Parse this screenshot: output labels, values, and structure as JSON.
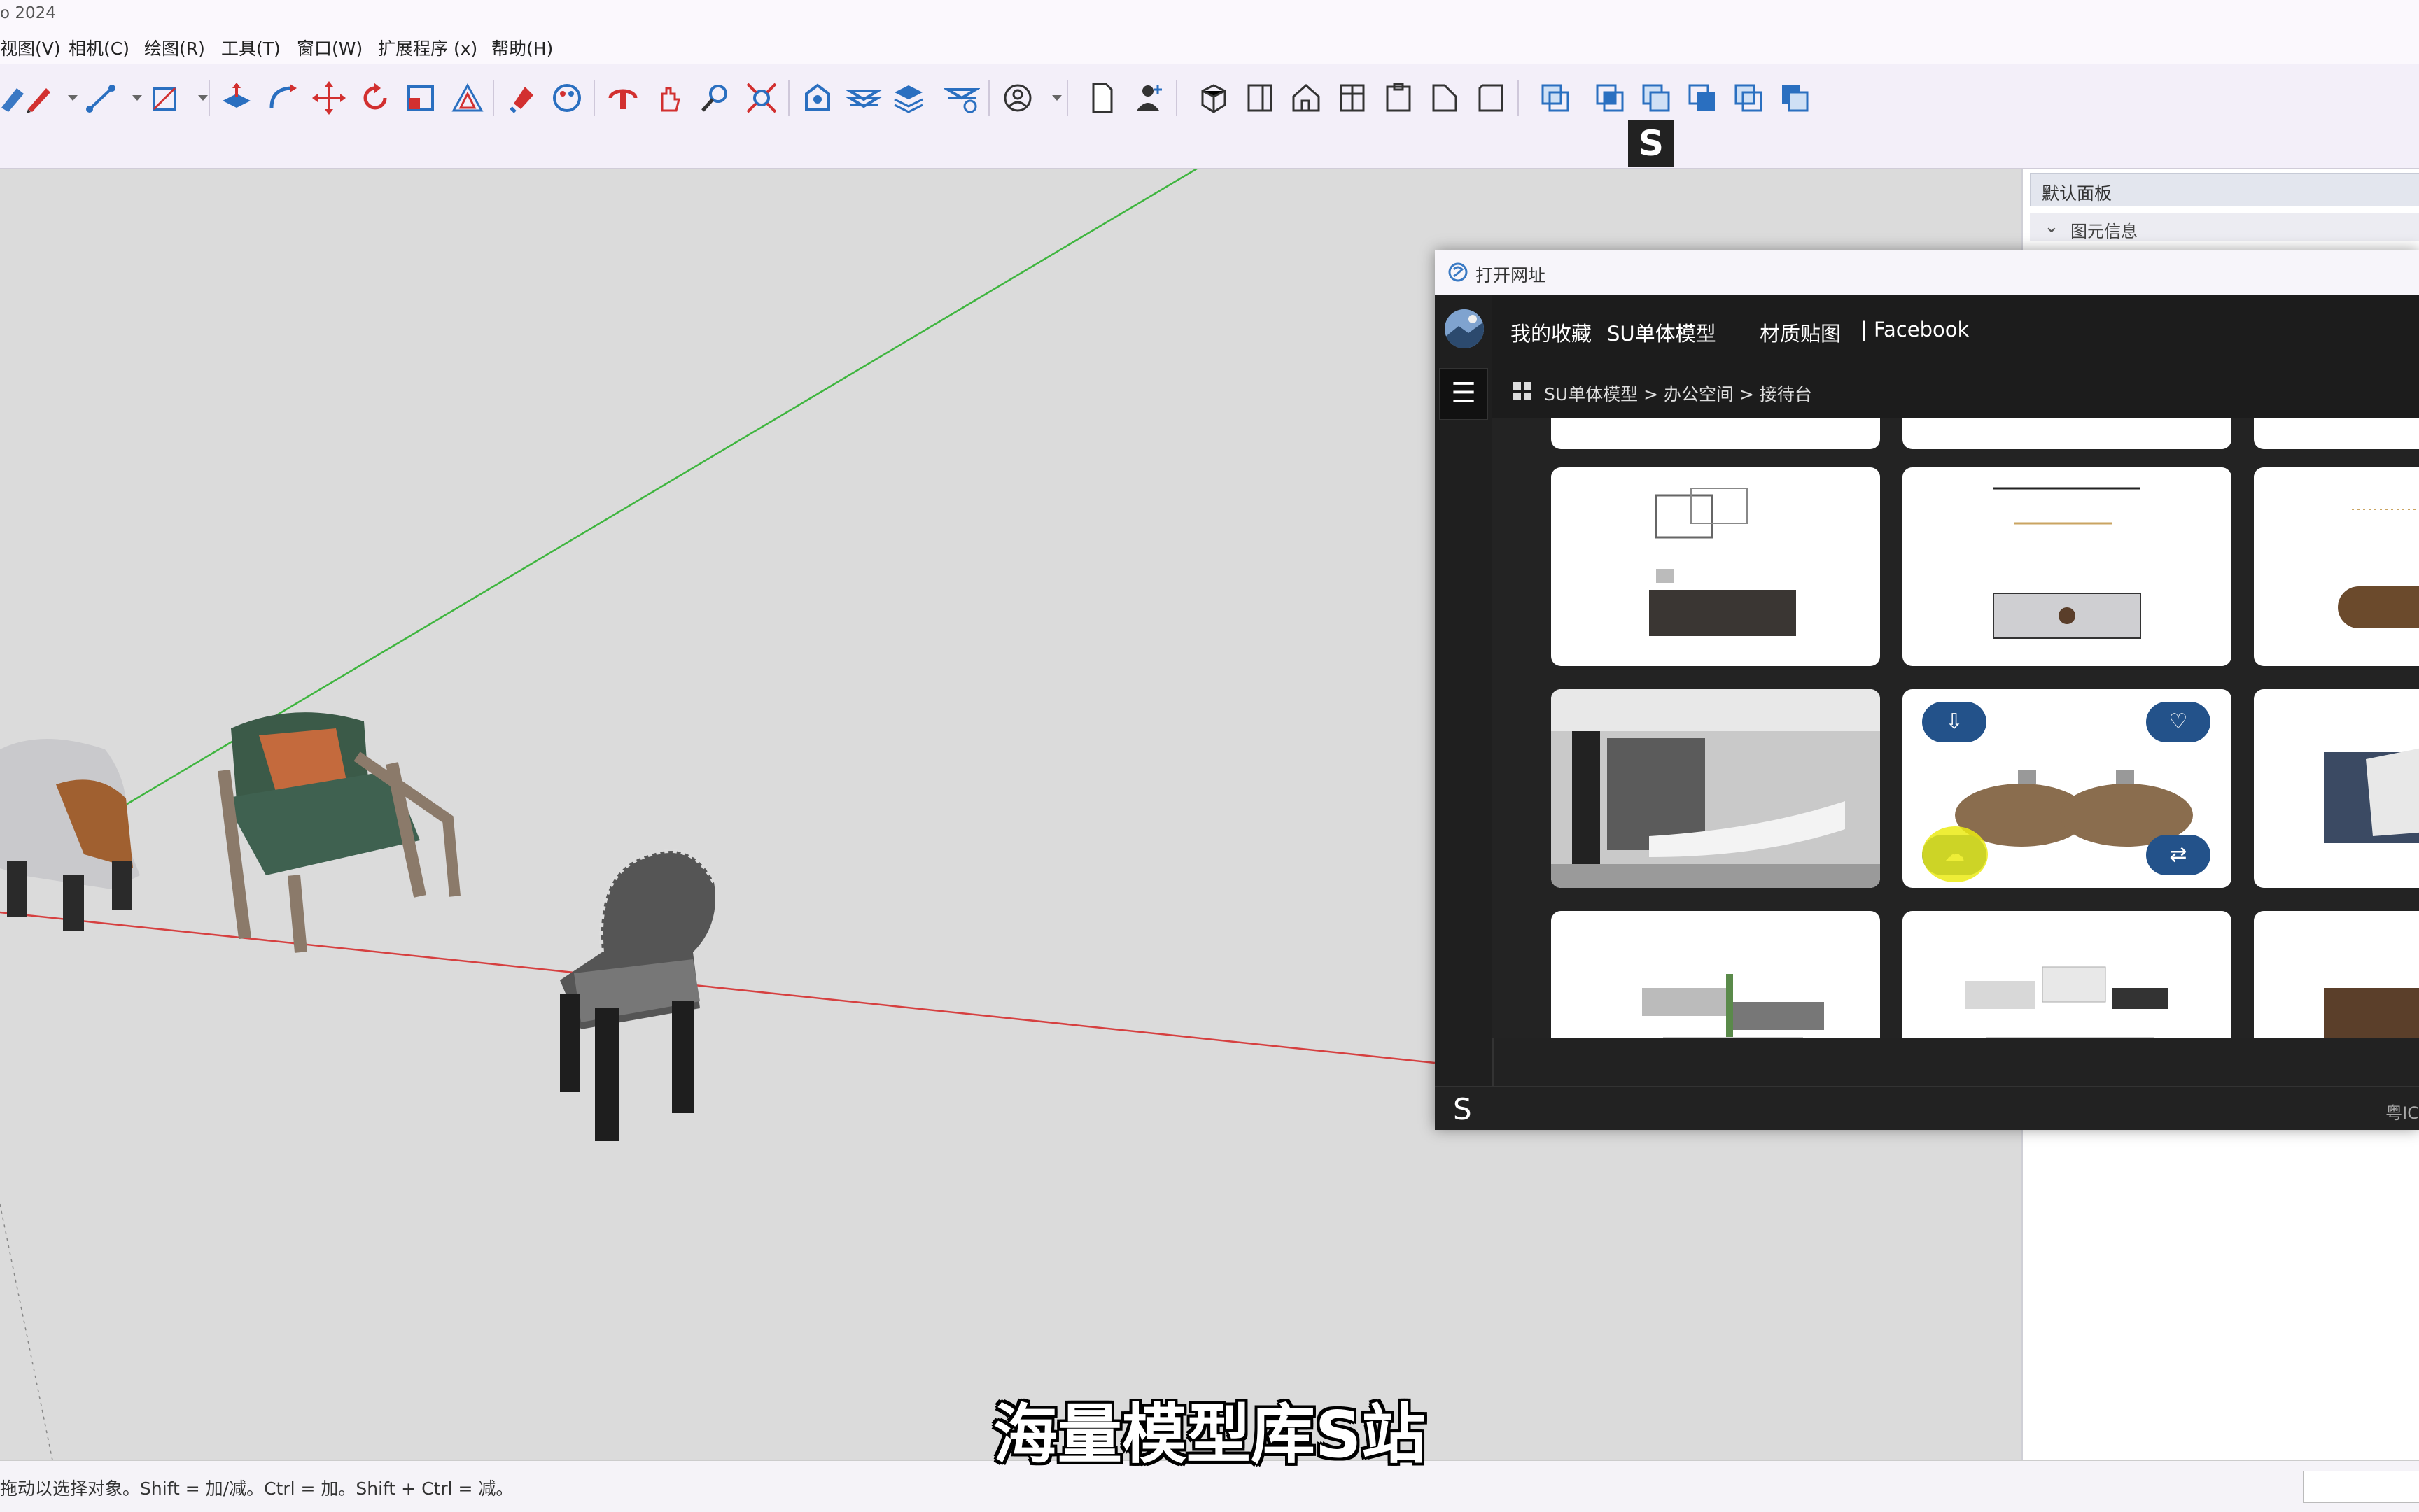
{
  "window": {
    "title_fragment": "o 2024"
  },
  "menu": [
    "视图(V)",
    "相机(C)",
    "绘图(R)",
    "工具(T)",
    "窗口(W)",
    "扩展程序 (x)",
    "帮助(H)"
  ],
  "s_badge": "S",
  "right_panel": {
    "title": "默认面板",
    "section": "图元信息"
  },
  "dialog": {
    "title": "打开网址",
    "nav": [
      "我的收藏",
      "SU单体模型",
      "材质贴图",
      "| Facebook"
    ],
    "breadcrumb": "SU单体模型 > 办公空间 > 接待台",
    "footer_logo": "S",
    "footer_version": "粤IC"
  },
  "status_text": "拖动以选择对象。Shift = 加/减。Ctrl = 加。Shift + Ctrl = 减。",
  "caption": "海量模型库S站",
  "colors": {
    "dialog_bg": "#222222",
    "accent_button": "#23528a",
    "hover": "#ebeb14",
    "x_axis": "#d64040",
    "y_axis": "#3fb53f"
  }
}
